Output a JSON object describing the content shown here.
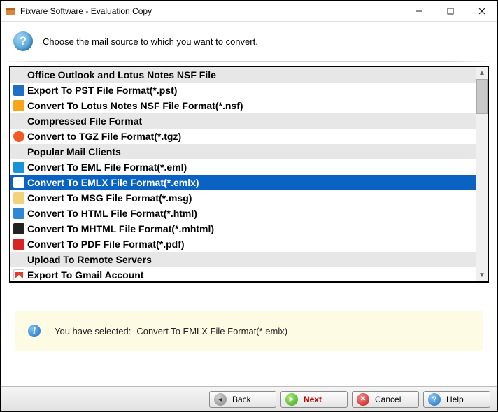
{
  "window": {
    "title": "Fixvare Software - Evaluation Copy"
  },
  "header": {
    "instruction": "Choose the mail source to which you want to convert."
  },
  "list": {
    "rows": [
      {
        "type": "header",
        "label": "Office Outlook and Lotus Notes NSF File",
        "icon": "blank"
      },
      {
        "type": "item",
        "label": "Export To PST File Format(*.pst)",
        "icon": "outlook"
      },
      {
        "type": "item",
        "label": "Convert To Lotus Notes NSF File Format(*.nsf)",
        "icon": "lotus"
      },
      {
        "type": "header",
        "label": "Compressed File Format",
        "icon": "blank"
      },
      {
        "type": "item",
        "label": "Convert to TGZ File Format(*.tgz)",
        "icon": "tgz"
      },
      {
        "type": "header",
        "label": "Popular Mail Clients",
        "icon": "blank"
      },
      {
        "type": "item",
        "label": "Convert To EML File Format(*.eml)",
        "icon": "eml"
      },
      {
        "type": "item",
        "label": "Convert To EMLX File Format(*.emlx)",
        "icon": "emlx",
        "selected": true
      },
      {
        "type": "item",
        "label": "Convert To MSG File Format(*.msg)",
        "icon": "msg"
      },
      {
        "type": "item",
        "label": "Convert To HTML File Format(*.html)",
        "icon": "html"
      },
      {
        "type": "item",
        "label": "Convert To MHTML File Format(*.mhtml)",
        "icon": "mhtml"
      },
      {
        "type": "item",
        "label": "Convert To PDF File Format(*.pdf)",
        "icon": "pdf"
      },
      {
        "type": "header",
        "label": "Upload To Remote Servers",
        "icon": "blank"
      },
      {
        "type": "item",
        "label": "Export To Gmail Account",
        "icon": "gmail"
      }
    ]
  },
  "info": {
    "message": "You have selected:- Convert To EMLX File Format(*.emlx)"
  },
  "buttons": {
    "back": "Back",
    "next": "Next",
    "cancel": "Cancel",
    "help": "Help"
  }
}
